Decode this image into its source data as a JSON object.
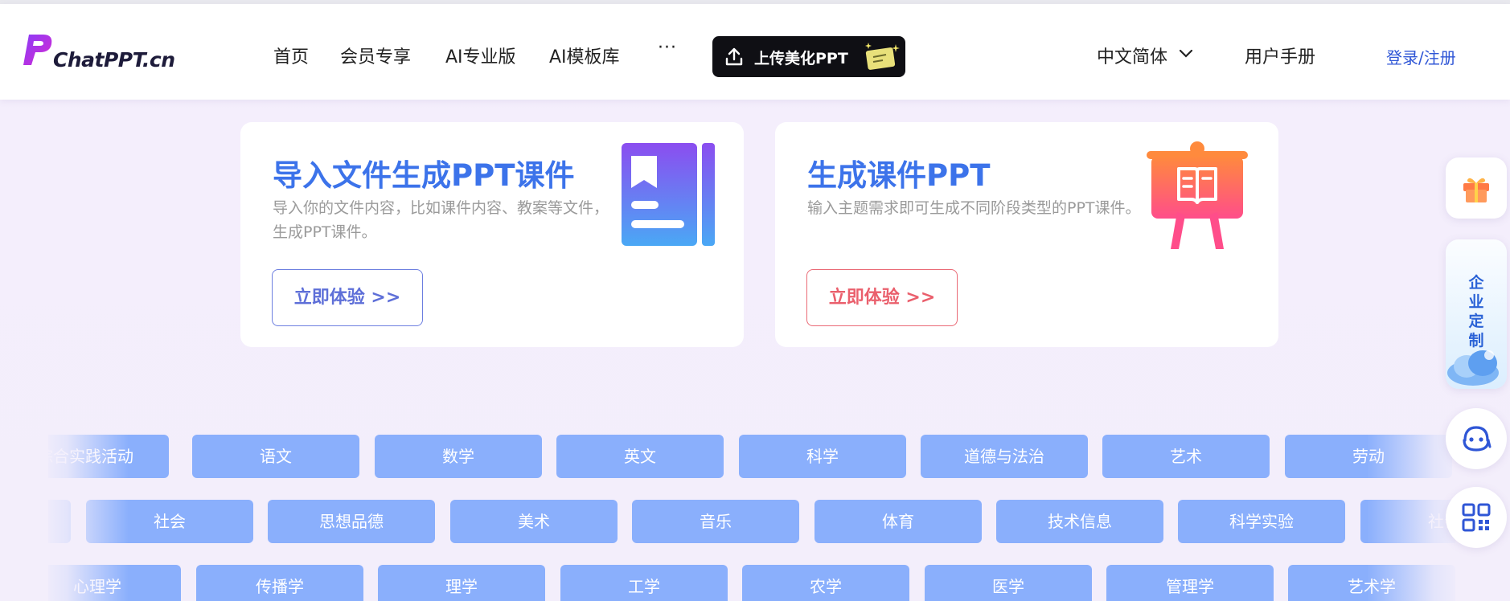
{
  "header": {
    "logo_text": "ChatPPT.cn",
    "nav": [
      "首页",
      "会员专享",
      "AI专业版",
      "AI模板库"
    ],
    "more_label": "···",
    "upload_label": "上传美化PPT",
    "language_label": "中文简体",
    "manual_label": "用户手册",
    "login_label": "登录/注册"
  },
  "cards": [
    {
      "title": "导入文件生成PPT课件",
      "description": "导入你的文件内容，比如课件内容、教案等文件，生成PPT课件。",
      "button_label": "立即体验 >>"
    },
    {
      "title": "生成课件PPT",
      "description": "输入主题需求即可生成不同阶段类型的PPT课件。",
      "button_label": "立即体验 >>"
    }
  ],
  "subjects": {
    "row1": [
      "综合实践活动",
      "语文",
      "数学",
      "英文",
      "科学",
      "道德与法治",
      "艺术",
      "劳动"
    ],
    "row2": [
      "",
      "社会",
      "思想品德",
      "美术",
      "音乐",
      "体育",
      "技术信息",
      "科学实验",
      "社会"
    ],
    "row3": [
      "心理学",
      "传播学",
      "理学",
      "工学",
      "农学",
      "医学",
      "管理学",
      "艺术学"
    ]
  },
  "floating": {
    "enterprise_label": "企业定制"
  },
  "colors": {
    "primary_blue": "#3c73ea",
    "pill_blue": "#8aaffc",
    "accent_red": "#ea5f6c",
    "login_blue": "#2f56d6"
  }
}
